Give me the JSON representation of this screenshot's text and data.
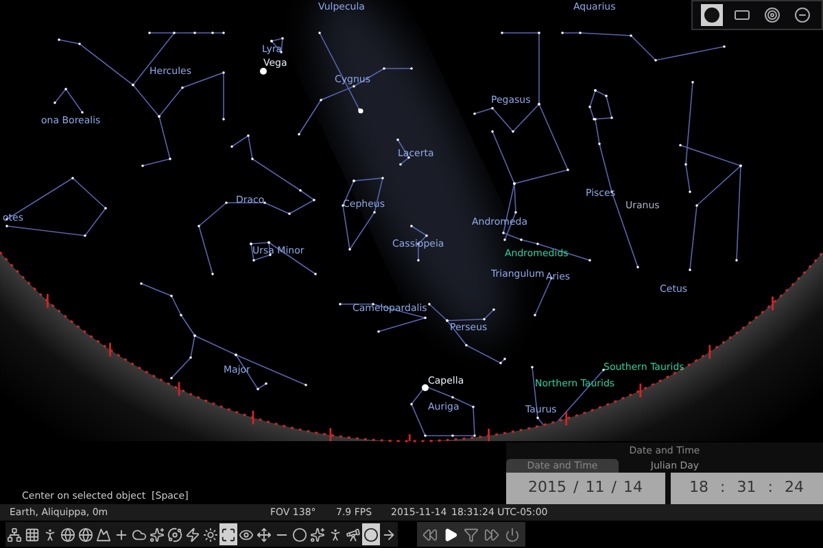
{
  "sky_labels": [
    {
      "text": "Aquarius",
      "kind": "constellation"
    },
    {
      "text": "Vulpecula",
      "kind": "constellation"
    },
    {
      "text": "Lyra",
      "kind": "constellation"
    },
    {
      "text": "Vega",
      "kind": "star"
    },
    {
      "text": "Hercules",
      "kind": "constellation"
    },
    {
      "text": "ona Borealis",
      "kind": "constellation"
    },
    {
      "text": "Cygnus",
      "kind": "constellation"
    },
    {
      "text": "Pegasus",
      "kind": "constellation"
    },
    {
      "text": "Lacerta",
      "kind": "constellation"
    },
    {
      "text": "otes",
      "kind": "constellation"
    },
    {
      "text": "Draco",
      "kind": "constellation"
    },
    {
      "text": "Cepheus",
      "kind": "constellation"
    },
    {
      "text": "Pisces",
      "kind": "constellation"
    },
    {
      "text": "Uranus",
      "kind": "planet"
    },
    {
      "text": "Cassiopeia",
      "kind": "constellation"
    },
    {
      "text": "Andromeda",
      "kind": "constellation"
    },
    {
      "text": "Ursa Minor",
      "kind": "constellation"
    },
    {
      "text": "Andromedids",
      "kind": "meteor_shower"
    },
    {
      "text": "Triangulum",
      "kind": "constellation"
    },
    {
      "text": "Aries",
      "kind": "constellation"
    },
    {
      "text": "Cetus",
      "kind": "constellation"
    },
    {
      "text": "Camelopardalis",
      "kind": "constellation"
    },
    {
      "text": "Perseus",
      "kind": "constellation"
    },
    {
      "text": "Major",
      "kind": "constellation"
    },
    {
      "text": "Northern Taurids",
      "kind": "meteor_shower"
    },
    {
      "text": "Southern Taurids",
      "kind": "meteor_shower"
    },
    {
      "text": "Capella",
      "kind": "star"
    },
    {
      "text": "Auriga",
      "kind": "constellation"
    },
    {
      "text": "Taurus",
      "kind": "constellation"
    }
  ],
  "view_panel": {
    "buttons": [
      {
        "selected": true
      },
      {
        "selected": false
      },
      {
        "selected": false
      },
      {
        "selected": false
      }
    ]
  },
  "hint": "Center on selected object  [Space]",
  "status_bar": {
    "location": "Earth, Aliquippa, 0m",
    "fov": "FOV 138°",
    "fps": "7.9 FPS",
    "date": "2015-11-14",
    "time": "18:31:24 UTC-05:00"
  },
  "toolbar": [
    {
      "selected": false
    },
    {
      "selected": false
    },
    {
      "selected": false
    },
    {
      "selected": false
    },
    {
      "selected": false
    },
    {
      "selected": false
    },
    {
      "selected": false
    },
    {
      "selected": false
    },
    {
      "selected": false
    },
    {
      "selected": false
    },
    {
      "selected": false
    },
    {
      "selected": false
    },
    {
      "selected": true
    },
    {
      "selected": false
    },
    {
      "selected": false
    },
    {
      "selected": false
    },
    {
      "selected": false
    },
    {
      "selected": false
    },
    {
      "selected": false
    },
    {
      "selected": false
    },
    {
      "selected": true
    },
    {
      "selected": false
    }
  ],
  "time_controls": [
    {
      "selected": false
    },
    {
      "selected": true
    },
    {
      "selected": false
    },
    {
      "selected": false
    },
    {
      "selected": false
    }
  ],
  "date_dialog": {
    "title": "Date and Time",
    "tabs": [
      {
        "label": "Date and Time",
        "selected": true
      },
      {
        "label": "Julian Day",
        "selected": false
      }
    ],
    "date_fields": [
      {
        "text": "2015",
        "kind": "value"
      },
      {
        "text": "/",
        "kind": "separator"
      },
      {
        "text": "11",
        "kind": "value"
      },
      {
        "text": "/",
        "kind": "separator"
      },
      {
        "text": "14",
        "kind": "value"
      }
    ],
    "time_fields": [
      {
        "text": "18",
        "kind": "value"
      },
      {
        "text": ":",
        "kind": "separator"
      },
      {
        "text": "31",
        "kind": "value"
      },
      {
        "text": ":",
        "kind": "separator"
      },
      {
        "text": "24",
        "kind": "value"
      }
    ]
  }
}
